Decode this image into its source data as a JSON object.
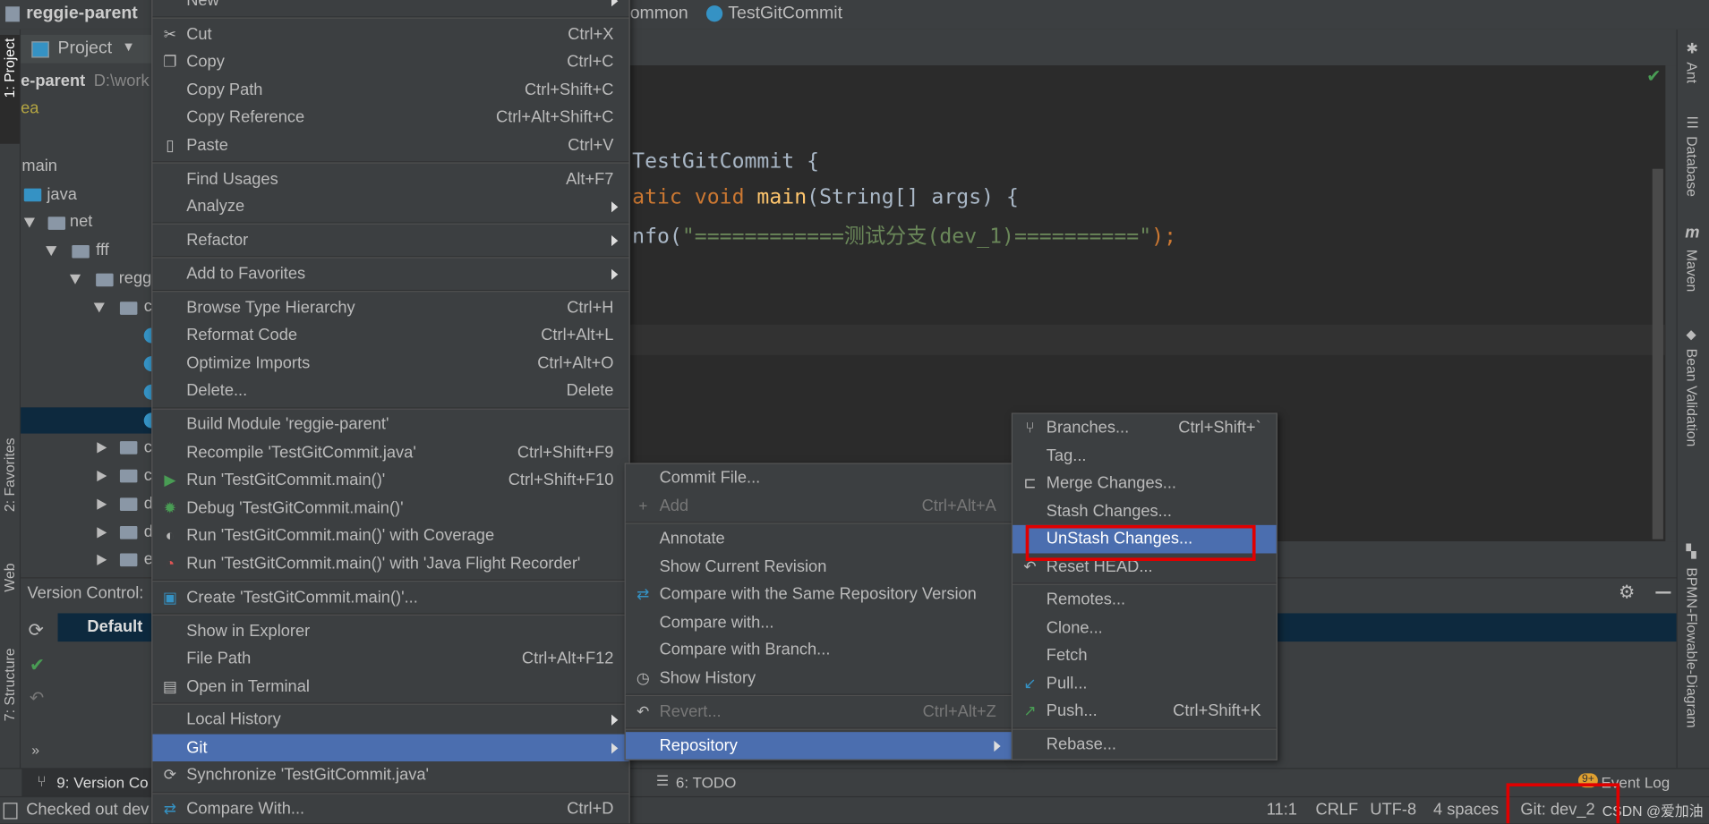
{
  "navbar": {
    "project": "reggie-parent",
    "crumb_partial": "ommon",
    "file": "TestGitCommit"
  },
  "left_tools": {
    "project": "1: Project",
    "favorites": "2: Favorites",
    "web": "Web",
    "structure": "7: Structure"
  },
  "right_tools": {
    "ant": "Ant",
    "database": "Database",
    "maven": "Maven",
    "bean": "Bean Validation",
    "bpmn": "BPMN-Flowable-Diagram"
  },
  "project_panel": {
    "title": "Project",
    "root": "e-parent",
    "root_path": "D:\\work",
    "idea": "ea",
    "tree": {
      "main": "main",
      "java": "java",
      "net": "net",
      "fff": "fff",
      "reggie": "regg",
      "c": "c",
      "c2": "c",
      "c3": "c",
      "d1": "d",
      "d2": "d",
      "e": "e"
    }
  },
  "editor": {
    "line1": {
      "name": "TestGitCommit {"
    },
    "line2": {
      "kw": "atic void ",
      "fn": "main",
      "rest": "(String[] args) {"
    },
    "line3": {
      "pre": "nfo(",
      "str": "\"============测试分支(dev_1)==========\"",
      "post": ");"
    }
  },
  "version_control": {
    "title": "Version Control:",
    "row": "Default"
  },
  "bottom_tools": {
    "vc": "9: Version Co",
    "todo": "6: TODO",
    "event_log": "Event Log",
    "event_badge": "9+"
  },
  "status": {
    "message": "Checked out dev",
    "position": "11:1",
    "line_sep": "CRLF",
    "encoding": "UTF-8",
    "indent": "4 spaces",
    "git": "Git: dev_2",
    "watermark": "CSDN @爱加油"
  },
  "context_menu": [
    {
      "label": "New",
      "submenu": true
    },
    {
      "sep": true
    },
    {
      "label": "Cut",
      "shortcut": "Ctrl+X",
      "icon": "scissors"
    },
    {
      "label": "Copy",
      "shortcut": "Ctrl+C",
      "icon": "copy"
    },
    {
      "label": "Copy Path",
      "shortcut": "Ctrl+Shift+C"
    },
    {
      "label": "Copy Reference",
      "shortcut": "Ctrl+Alt+Shift+C"
    },
    {
      "label": "Paste",
      "shortcut": "Ctrl+V",
      "icon": "clipboard"
    },
    {
      "sep": true
    },
    {
      "label": "Find Usages",
      "shortcut": "Alt+F7"
    },
    {
      "label": "Analyze",
      "submenu": true
    },
    {
      "sep": true
    },
    {
      "label": "Refactor",
      "submenu": true
    },
    {
      "sep": true
    },
    {
      "label": "Add to Favorites",
      "submenu": true
    },
    {
      "sep": true
    },
    {
      "label": "Browse Type Hierarchy",
      "shortcut": "Ctrl+H"
    },
    {
      "label": "Reformat Code",
      "shortcut": "Ctrl+Alt+L"
    },
    {
      "label": "Optimize Imports",
      "shortcut": "Ctrl+Alt+O"
    },
    {
      "label": "Delete...",
      "shortcut": "Delete"
    },
    {
      "sep": true
    },
    {
      "label": "Build Module 'reggie-parent'"
    },
    {
      "label": "Recompile 'TestGitCommit.java'",
      "shortcut": "Ctrl+Shift+F9"
    },
    {
      "label": "Run 'TestGitCommit.main()'",
      "shortcut": "Ctrl+Shift+F10",
      "icon": "run"
    },
    {
      "label": "Debug 'TestGitCommit.main()'",
      "icon": "debug"
    },
    {
      "label": "Run 'TestGitCommit.main()' with Coverage",
      "icon": "coverage"
    },
    {
      "label": "Run 'TestGitCommit.main()' with 'Java Flight Recorder'",
      "icon": "profiler"
    },
    {
      "sep": true
    },
    {
      "label": "Create 'TestGitCommit.main()'...",
      "icon": "window"
    },
    {
      "sep": true
    },
    {
      "label": "Show in Explorer"
    },
    {
      "label": "File Path",
      "shortcut": "Ctrl+Alt+F12"
    },
    {
      "label": "Open in Terminal",
      "icon": "terminal"
    },
    {
      "sep": true
    },
    {
      "label": "Local History",
      "submenu": true
    },
    {
      "label": "Git",
      "submenu": true,
      "highlighted": true
    },
    {
      "label": "Synchronize 'TestGitCommit.java'",
      "icon": "sync"
    },
    {
      "sep": true
    },
    {
      "label": "Compare With...",
      "shortcut": "Ctrl+D",
      "icon": "compare"
    },
    {
      "sep": true
    }
  ],
  "git_menu": [
    {
      "label": "Commit File..."
    },
    {
      "label": "Add",
      "shortcut": "Ctrl+Alt+A",
      "icon": "plus",
      "disabled": true
    },
    {
      "sep": true
    },
    {
      "label": "Annotate"
    },
    {
      "label": "Show Current Revision"
    },
    {
      "label": "Compare with the Same Repository Version",
      "icon": "compare"
    },
    {
      "label": "Compare with..."
    },
    {
      "label": "Compare with Branch..."
    },
    {
      "label": "Show History",
      "icon": "clock"
    },
    {
      "sep": true
    },
    {
      "label": "Revert...",
      "shortcut": "Ctrl+Alt+Z",
      "icon": "undo",
      "disabled": true
    },
    {
      "sep": true
    },
    {
      "label": "Repository",
      "submenu": true,
      "highlighted": true
    }
  ],
  "repository_menu": [
    {
      "label": "Branches...",
      "shortcut": "Ctrl+Shift+`",
      "icon": "branch"
    },
    {
      "label": "Tag..."
    },
    {
      "label": "Merge Changes...",
      "icon": "merge"
    },
    {
      "label": "Stash Changes..."
    },
    {
      "label": "UnStash Changes...",
      "highlighted": true
    },
    {
      "label": "Reset HEAD...",
      "icon": "undo"
    },
    {
      "sep": true
    },
    {
      "label": "Remotes..."
    },
    {
      "label": "Clone..."
    },
    {
      "label": "Fetch"
    },
    {
      "label": "Pull...",
      "icon": "pull"
    },
    {
      "label": "Push...",
      "shortcut": "Ctrl+Shift+K",
      "icon": "push"
    },
    {
      "sep": true
    },
    {
      "label": "Rebase..."
    }
  ],
  "colors": {
    "menu_bg": "#3c3f41",
    "highlight": "#4b6eaf",
    "editor_bg": "#2b2b2b",
    "annotation_red": "#e00000",
    "keyword": "#cc7832",
    "string": "#6a8759"
  }
}
